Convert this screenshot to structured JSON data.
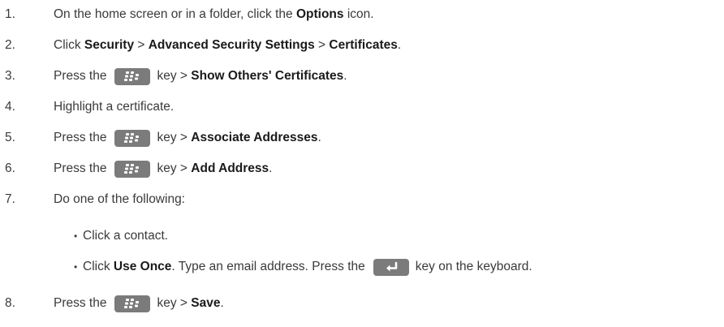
{
  "steps": [
    {
      "num": "1.",
      "a": "On the home screen or in a folder, click the ",
      "b": "Options",
      "c": " icon."
    },
    {
      "num": "2.",
      "a": "Click ",
      "b1": "Security",
      "s1": " > ",
      "b2": "Advanced Security Settings",
      "s2": " > ",
      "b3": "Certificates",
      "end": "."
    },
    {
      "num": "3.",
      "a": "Press the",
      "key": "menu-key-icon",
      "c": "key > ",
      "b": "Show Others' Certificates",
      "end": "."
    },
    {
      "num": "4.",
      "a": "Highlight a certificate."
    },
    {
      "num": "5.",
      "a": "Press the",
      "key": "menu-key-icon",
      "c": "key > ",
      "b": "Associate Addresses",
      "end": "."
    },
    {
      "num": "6.",
      "a": "Press the",
      "key": "menu-key-icon",
      "c": "key > ",
      "b": "Add Address",
      "end": "."
    },
    {
      "num": "7.",
      "a": "Do one of the following:"
    },
    {
      "num": "8.",
      "a": "Press the",
      "key": "menu-key-icon",
      "c": "key > ",
      "b": "Save",
      "end": "."
    }
  ],
  "substeps": [
    {
      "bullet": "•",
      "a": "Click a contact."
    },
    {
      "bullet": "•",
      "a": "Click ",
      "b": "Use Once",
      "c": ". Type an email address. Press the",
      "key": "enter-key-icon",
      "d": "key on the keyboard."
    }
  ]
}
